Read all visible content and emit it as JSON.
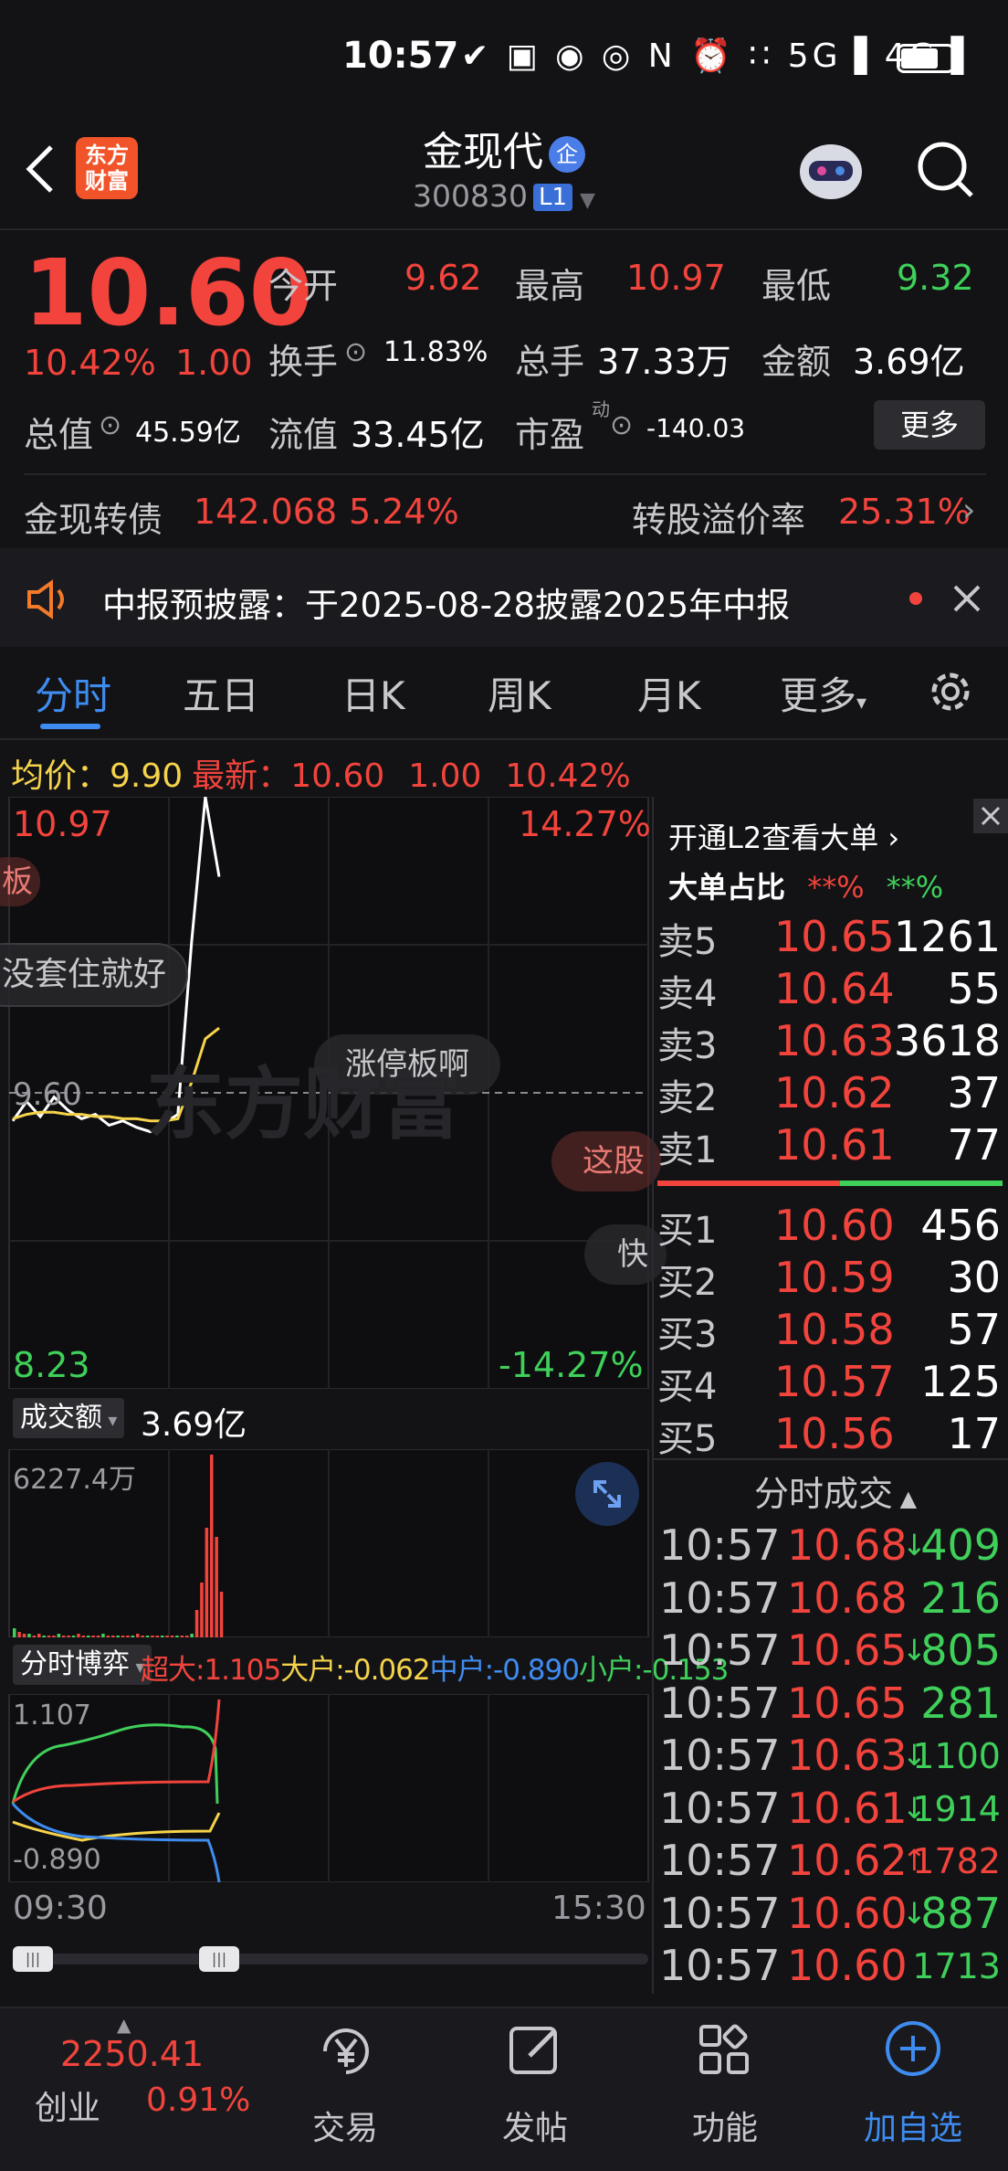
{
  "status_bar": {
    "time": "10:57",
    "icons": "✔ ▣ ◉ ◎ N ⏰ ∷ 5G▐ 4G▐"
  },
  "header": {
    "title": "金现代",
    "badge": "企",
    "code": "300830",
    "level": "L1",
    "logo_text_1": "东方",
    "logo_text_2": "财富"
  },
  "quote": {
    "price": "10.60",
    "change_pct": "10.42%",
    "change": "1.00",
    "open_label": "今开",
    "open": "9.62",
    "high_label": "最高",
    "high": "10.97",
    "low_label": "最低",
    "low": "9.32",
    "turnover_label": "换手",
    "turnover": "11.83%",
    "volume_label": "总手",
    "volume": "37.33万",
    "amount_label": "金额",
    "amount": "3.69亿",
    "mktcap_label": "总值",
    "mktcap": "45.59亿",
    "float_label": "流值",
    "float": "33.45亿",
    "pe_label": "市盈",
    "pe_sup": "动",
    "pe": "-140.03",
    "more": "更多"
  },
  "bond": {
    "name": "金现转债",
    "price": "142.068",
    "pct": "5.24%",
    "premium_label": "转股溢价率",
    "premium": "25.31%"
  },
  "notice": {
    "text": "中报预披露：于2025-08-28披露2025年中报"
  },
  "tabs": [
    "分时",
    "五日",
    "日K",
    "周K",
    "月K",
    "更多"
  ],
  "chart_header": {
    "avg_label": "均价：",
    "avg": "9.90",
    "last_label": "最新：",
    "last": "10.60",
    "chg": "1.00",
    "pct": "10.42%"
  },
  "chart_data": [
    {
      "type": "line",
      "title": "",
      "x": [
        "09:30",
        "15:30"
      ],
      "ylim": [
        8.23,
        10.97
      ],
      "y_right_labels": [
        "14.27%",
        "-14.27%"
      ],
      "prev_close": 9.6,
      "series": [
        {
          "name": "",
          "color": "#ffffff",
          "values": [
            9.47,
            9.56,
            9.49,
            9.58,
            9.52,
            9.48,
            9.5,
            9.45,
            9.47,
            9.44,
            9.42,
            9.46,
            9.5,
            10.3,
            10.97,
            10.6
          ]
        },
        {
          "name": "",
          "color": "#f5d34a",
          "values": [
            9.48,
            9.5,
            9.51,
            9.51,
            9.5,
            9.5,
            9.49,
            9.49,
            9.48,
            9.48,
            9.47,
            9.47,
            9.48,
            9.65,
            9.85,
            9.9
          ]
        }
      ]
    },
    {
      "type": "bar",
      "title": "成交额",
      "total": "3.69亿",
      "ylim_max_label": "6227.4万",
      "values": [
        5,
        3,
        2,
        2,
        1,
        2,
        1,
        1,
        1,
        2,
        1,
        1,
        1,
        2,
        1,
        1,
        1,
        1,
        2,
        1,
        1,
        1,
        1,
        1,
        1,
        2,
        1,
        1,
        1,
        1,
        1,
        1,
        1,
        1,
        1,
        1,
        2,
        15,
        30,
        60,
        100,
        55,
        25
      ]
    },
    {
      "type": "line",
      "title": "分时博弈",
      "y_top_label": "1.107",
      "y_bottom_label": "-0.890",
      "series": [
        {
          "name": "超大",
          "value": "1.105",
          "color": "#f2443c"
        },
        {
          "name": "大户",
          "value": "-0.062",
          "color": "#f5d34a"
        },
        {
          "name": "中户",
          "value": "-0.890",
          "color": "#3f8cf0"
        },
        {
          "name": "小户",
          "value": "-0.153",
          "color": "#3fd05a"
        }
      ]
    }
  ],
  "chart_labels": {
    "top_price": "10.97",
    "top_pct": "14.27%",
    "bottom_price": "8.23",
    "bottom_pct": "-14.27%",
    "prev_close": "9.60",
    "watermark": "东方财富",
    "bubble_1": "涨停板啊",
    "bubble_2": "没套住就好",
    "bubble_3": "这股",
    "bubble_4": "快",
    "bubble_5": "板",
    "volume_label": "成交额",
    "volume_total": "3.69亿",
    "volume_max": "6227.4万",
    "flow_label": "分时博弈",
    "flow_top": "1.107",
    "flow_bottom": "-0.890",
    "time_start": "09:30",
    "time_end": "15:30"
  },
  "order_book": {
    "l2_text": "开通L2查看大单",
    "big_ratio_label": "大单占比",
    "big_red": "**%",
    "big_green": "**%",
    "asks": [
      {
        "label": "卖5",
        "price": "10.65",
        "vol": "1261"
      },
      {
        "label": "卖4",
        "price": "10.64",
        "vol": "55"
      },
      {
        "label": "卖3",
        "price": "10.63",
        "vol": "3618"
      },
      {
        "label": "卖2",
        "price": "10.62",
        "vol": "37"
      },
      {
        "label": "卖1",
        "price": "10.61",
        "vol": "77"
      }
    ],
    "bids": [
      {
        "label": "买1",
        "price": "10.60",
        "vol": "456"
      },
      {
        "label": "买2",
        "price": "10.59",
        "vol": "30"
      },
      {
        "label": "买3",
        "price": "10.58",
        "vol": "57"
      },
      {
        "label": "买4",
        "price": "10.57",
        "vol": "125"
      },
      {
        "label": "买5",
        "price": "10.56",
        "vol": "17"
      }
    ]
  },
  "trades": {
    "title": "分时成交",
    "rows": [
      {
        "time": "10:57",
        "price": "10.68",
        "arrow": "↓",
        "vol": "409"
      },
      {
        "time": "10:57",
        "price": "10.68",
        "arrow": "",
        "vol": "216"
      },
      {
        "time": "10:57",
        "price": "10.65",
        "arrow": "↓",
        "vol": "805"
      },
      {
        "time": "10:57",
        "price": "10.65",
        "arrow": "",
        "vol": "281"
      },
      {
        "time": "10:57",
        "price": "10.63",
        "arrow": "↓",
        "vol": "1100"
      },
      {
        "time": "10:57",
        "price": "10.61",
        "arrow": "↓",
        "vol": "1914"
      },
      {
        "time": "10:57",
        "price": "10.62",
        "arrow": "↑",
        "vol": "1782"
      },
      {
        "time": "10:57",
        "price": "10.60",
        "arrow": "↓",
        "vol": "887"
      },
      {
        "time": "10:57",
        "price": "10.60",
        "arrow": "",
        "vol": "1713"
      }
    ]
  },
  "bottom_nav": {
    "index_value": "2250.41",
    "index_name": "创业",
    "index_pct": "0.91%",
    "items": [
      "交易",
      "发帖",
      "功能",
      "加自选"
    ]
  }
}
